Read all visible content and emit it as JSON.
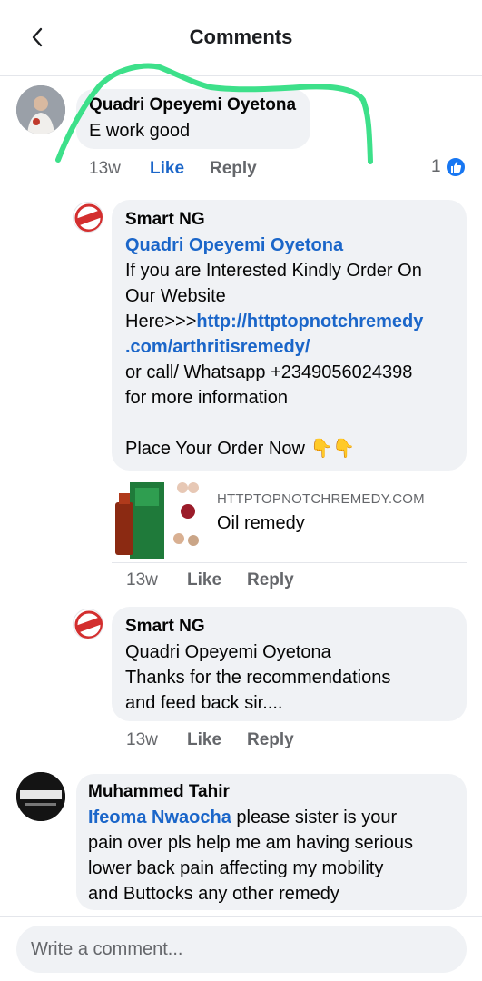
{
  "header": {
    "title": "Comments"
  },
  "comments": [
    {
      "author": "Quadri Opeyemi Oyetona",
      "text": "E work good",
      "time": "13w",
      "like": "Like",
      "reply": "Reply",
      "reaction_count": "1",
      "reaction_icon": "thumbs-up-icon"
    }
  ],
  "replies": [
    {
      "author": "Smart NG",
      "mention": "Quadri Opeyemi Oyetona",
      "line1": "If you are Interested Kindly Order On",
      "line2": "Our Website",
      "line3_prefix": "Here>>>",
      "link1": "http://httptopnotchremedy",
      "link2": ".com/arthritisremedy/",
      "line4": "or call/ Whatsapp +2349056024398",
      "line5": "for more information",
      "line6": "Place Your Order Now 👇👇",
      "preview_domain": "HTTPTOPNOTCHREMEDY.COM",
      "preview_title": "Oil remedy",
      "time": "13w",
      "like": "Like",
      "reply": "Reply"
    },
    {
      "author": "Smart NG",
      "line1": "Quadri Opeyemi Oyetona",
      "line2": "Thanks for the recommendations",
      "line3": "and feed back sir....",
      "time": "13w",
      "like": "Like",
      "reply": "Reply"
    }
  ],
  "comment2": {
    "author": "Muhammed Tahir",
    "mention": "Ifeoma Nwaocha",
    "line1_rest": " please sister is your",
    "line2": "pain over pls help me am having serious",
    "line3": "lower back pain affecting my mobility",
    "line4": "and Buttocks any other remedy"
  },
  "composer": {
    "placeholder": "Write a comment..."
  },
  "colors": {
    "accent": "#1b66c9",
    "bubble": "#f0f2f5",
    "highlight": "#3de08a"
  }
}
